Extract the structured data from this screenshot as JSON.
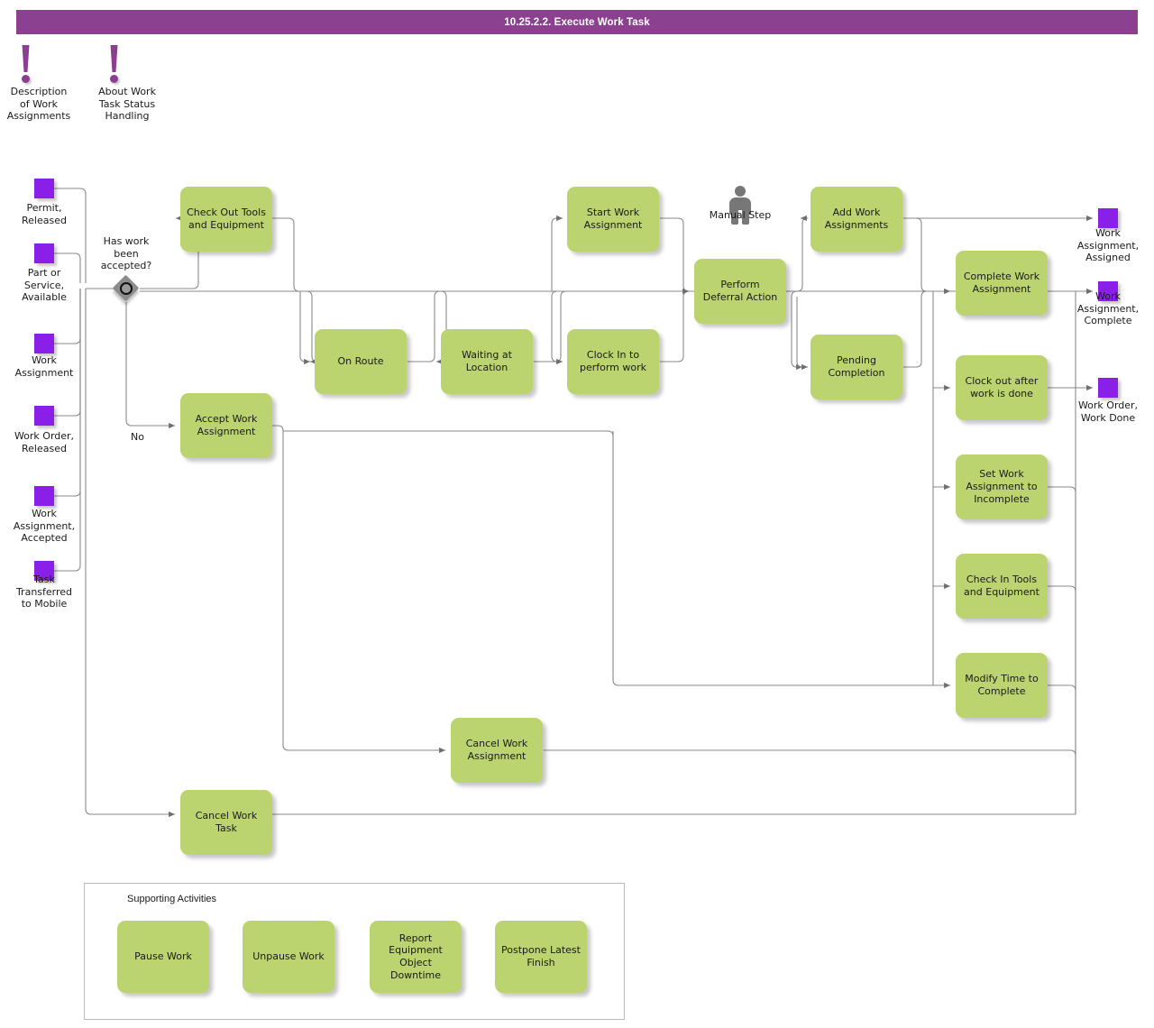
{
  "header": {
    "title": "10.25.2.2. Execute Work Task",
    "bar_color": "#8B4090"
  },
  "palette": {
    "task_fill": "#BBD46F",
    "event_fill": "#8A20E8",
    "gateway_fill": "#8C8C8C",
    "connector": "#777777",
    "annotation": "#8B3F90",
    "person_icon": "#777777"
  },
  "annotations": [
    {
      "id": "anno-description-of-work-assignments",
      "icon": "exclamation-icon",
      "label": "Description\nof Work\nAssignments"
    },
    {
      "id": "anno-about-work-task-status-handling",
      "icon": "exclamation-icon",
      "label": "About Work\nTask Status\nHandling"
    }
  ],
  "start_events": [
    {
      "id": "evt-permit-released",
      "label": "Permit,\nReleased"
    },
    {
      "id": "evt-part-or-service-available",
      "label": "Part or\nService,\nAvailable"
    },
    {
      "id": "evt-work-assignment",
      "label": "Work\nAssignment"
    },
    {
      "id": "evt-work-order-released",
      "label": "Work Order,\nReleased"
    },
    {
      "id": "evt-work-assignment-accepted",
      "label": "Work\nAssignment,\nAccepted"
    },
    {
      "id": "evt-task-transferred-to-mobile",
      "label": "Task\nTransferred\nto Mobile"
    }
  ],
  "end_events": [
    {
      "id": "evt-work-assignment-assigned",
      "label": "Work\nAssignment,\nAssigned"
    },
    {
      "id": "evt-work-assignment-complete",
      "label": "Work\nAssignment,\nComplete"
    },
    {
      "id": "evt-work-order-work-done",
      "label": "Work Order,\nWork Done"
    }
  ],
  "gateway": {
    "id": "gateway-has-work-been-accepted",
    "label": "Has work\nbeen\naccepted?",
    "type": "event-based-gateway",
    "branch_label_no": "No"
  },
  "manual_step": {
    "id": "manual-step-marker",
    "label": "Manual Step",
    "icon": "person-icon"
  },
  "tasks": [
    {
      "id": "task-check-out-tools-and-equipment",
      "label": "Check Out Tools\nand Equipment"
    },
    {
      "id": "task-accept-work-assignment",
      "label": "Accept Work\nAssignment"
    },
    {
      "id": "task-on-route",
      "label": "On Route"
    },
    {
      "id": "task-waiting-at-location",
      "label": "Waiting at\nLocation"
    },
    {
      "id": "task-start-work-assignment",
      "label": "Start Work\nAssignment"
    },
    {
      "id": "task-clock-in-to-perform-work",
      "label": "Clock In to\nperform work"
    },
    {
      "id": "task-perform-deferral-action",
      "label": "Perform\nDeferral Action"
    },
    {
      "id": "task-add-work-assignments",
      "label": "Add Work\nAssignments"
    },
    {
      "id": "task-pending-completion",
      "label": "Pending\nCompletion"
    },
    {
      "id": "task-complete-work-assignment",
      "label": "Complete Work\nAssignment"
    },
    {
      "id": "task-clock-out-after-work-is-done",
      "label": "Clock out after\nwork is done"
    },
    {
      "id": "task-set-work-assignment-to-incomplete",
      "label": "Set Work\nAssignment to\nIncomplete"
    },
    {
      "id": "task-check-in-tools-and-equipment",
      "label": "Check In Tools\nand Equipment"
    },
    {
      "id": "task-modify-time-to-complete",
      "label": "Modify Time to\nComplete"
    },
    {
      "id": "task-cancel-work-assignment",
      "label": "Cancel Work\nAssignment"
    },
    {
      "id": "task-cancel-work-task",
      "label": "Cancel Work\nTask"
    }
  ],
  "supporting_activities": {
    "title": "Supporting Activities",
    "items": [
      {
        "id": "task-pause-work",
        "label": "Pause Work"
      },
      {
        "id": "task-unpause-work",
        "label": "Unpause Work"
      },
      {
        "id": "task-report-equipment-object-downtime",
        "label": "Report\nEquipment\nObject\nDowntime"
      },
      {
        "id": "task-postpone-latest-finish",
        "label": "Postpone Latest\nFinish"
      }
    ]
  }
}
